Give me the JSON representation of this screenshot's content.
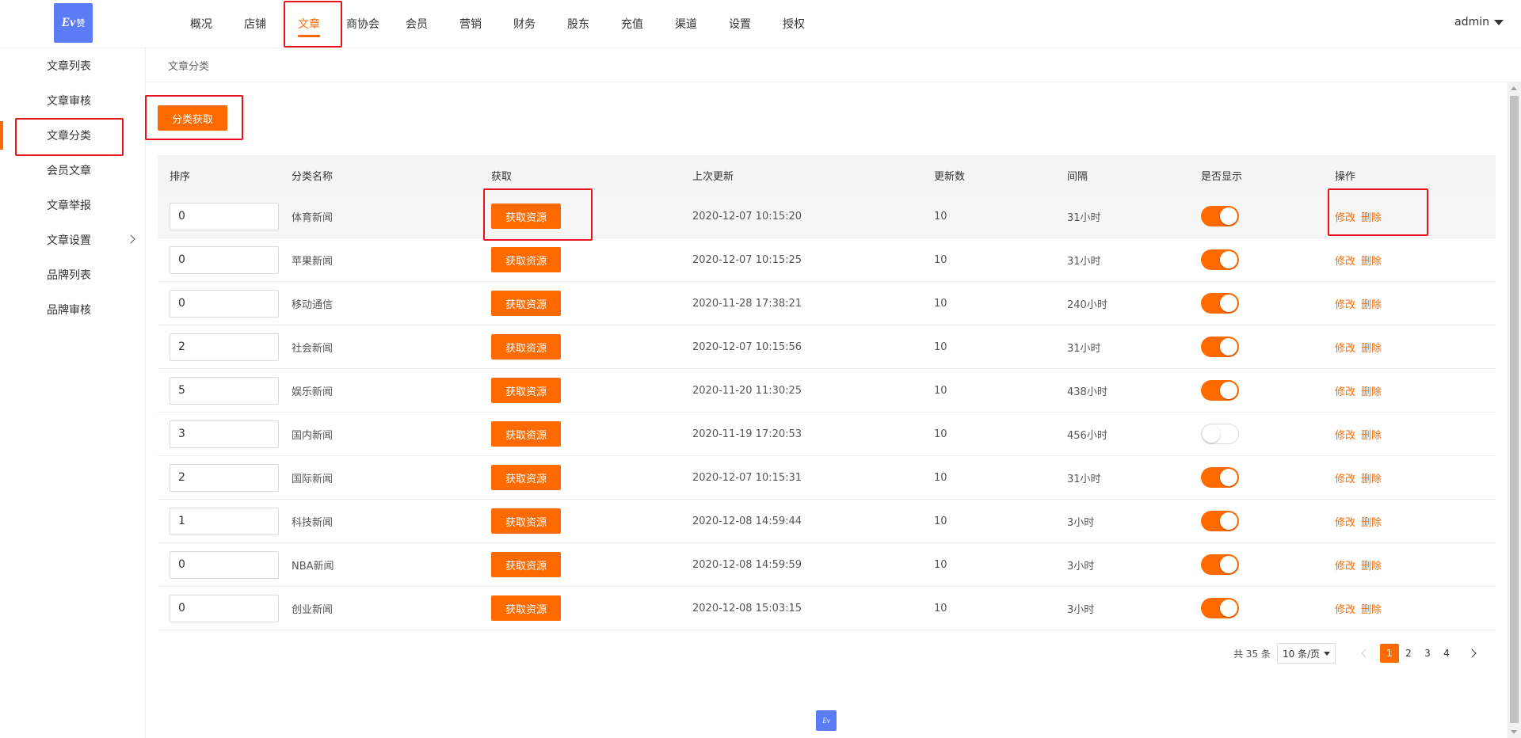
{
  "header": {
    "logo_text": "Ev",
    "logo_sub": "赞",
    "nav": [
      "概况",
      "店铺",
      "文章",
      "商协会",
      "会员",
      "营销",
      "财务",
      "股东",
      "充值",
      "渠道",
      "设置",
      "授权"
    ],
    "active_nav_index": 2,
    "user": "admin"
  },
  "sidebar": {
    "items": [
      "文章列表",
      "文章审核",
      "文章分类",
      "会员文章",
      "文章举报",
      "文章设置",
      "品牌列表",
      "品牌审核"
    ],
    "active_index": 2
  },
  "breadcrumb": "文章分类",
  "fetch_button": "分类获取",
  "table": {
    "columns": [
      "排序",
      "分类名称",
      "获取",
      "上次更新",
      "更新数",
      "间隔",
      "是否显示",
      "操作"
    ],
    "get_label": "获取资源",
    "edit_label": "修改",
    "delete_label": "删除",
    "rows": [
      {
        "sort": "0",
        "name": "体育新闻",
        "updated": "2020-12-07 10:15:20",
        "count": "10",
        "interval": "31小时",
        "show": true
      },
      {
        "sort": "0",
        "name": "苹果新闻",
        "updated": "2020-12-07 10:15:25",
        "count": "10",
        "interval": "31小时",
        "show": true
      },
      {
        "sort": "0",
        "name": "移动通信",
        "updated": "2020-11-28 17:38:21",
        "count": "10",
        "interval": "240小时",
        "show": true
      },
      {
        "sort": "2",
        "name": "社会新闻",
        "updated": "2020-12-07 10:15:56",
        "count": "10",
        "interval": "31小时",
        "show": true
      },
      {
        "sort": "5",
        "name": "娱乐新闻",
        "updated": "2020-11-20 11:30:25",
        "count": "10",
        "interval": "438小时",
        "show": true
      },
      {
        "sort": "3",
        "name": "国内新闻",
        "updated": "2020-11-19 17:20:53",
        "count": "10",
        "interval": "456小时",
        "show": false
      },
      {
        "sort": "2",
        "name": "国际新闻",
        "updated": "2020-12-07 10:15:31",
        "count": "10",
        "interval": "31小时",
        "show": true
      },
      {
        "sort": "1",
        "name": "科技新闻",
        "updated": "2020-12-08 14:59:44",
        "count": "10",
        "interval": "3小时",
        "show": true
      },
      {
        "sort": "0",
        "name": "NBA新闻",
        "updated": "2020-12-08 14:59:59",
        "count": "10",
        "interval": "3小时",
        "show": true
      },
      {
        "sort": "0",
        "name": "创业新闻",
        "updated": "2020-12-08 15:03:15",
        "count": "10",
        "interval": "3小时",
        "show": true
      }
    ]
  },
  "pagination": {
    "total": "共 35 条",
    "page_size": "10 条/页",
    "pages": [
      "1",
      "2",
      "3",
      "4"
    ],
    "current": "1"
  },
  "colors": {
    "accent": "#ff6a00",
    "highlight_box": "#e8141b",
    "logo_bg": "#5b7cf6"
  }
}
